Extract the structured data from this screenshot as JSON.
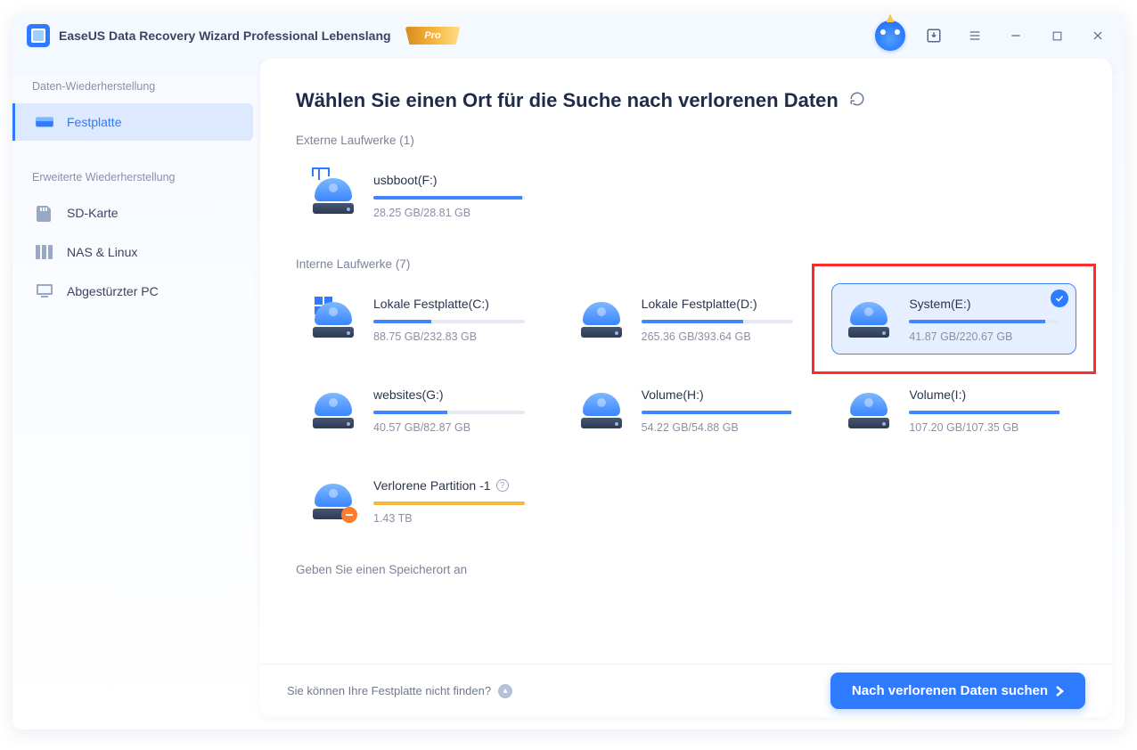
{
  "app_title": "EaseUS Data Recovery Wizard Professional Lebenslang",
  "pro_badge": "Pro",
  "sidebar": {
    "section1_label": "Daten-Wiederherstellung",
    "festplatte": "Festplatte",
    "section2_label": "Erweiterte Wiederherstellung",
    "sdkarte": "SD-Karte",
    "nas": "NAS & Linux",
    "crashed": "Abgestürzter PC"
  },
  "main": {
    "heading": "Wählen Sie einen Ort für die Suche nach verlorenen Daten",
    "section_external": "Externe Laufwerke (1)",
    "section_internal": "Interne Laufwerke (7)",
    "section_custom": "Geben Sie einen Speicherort an",
    "drives_external": [
      {
        "name": "usbboot(F:)",
        "size": "28.25 GB/28.81 GB",
        "pct": 98
      }
    ],
    "drives_internal": [
      {
        "name": "Lokale Festplatte(C:)",
        "size": "88.75 GB/232.83 GB",
        "pct": 38,
        "win": true
      },
      {
        "name": "Lokale Festplatte(D:)",
        "size": "265.36 GB/393.64 GB",
        "pct": 67
      },
      {
        "name": "System(E:)",
        "size": "41.87 GB/220.67 GB",
        "pct": 90,
        "selected": true
      },
      {
        "name": "websites(G:)",
        "size": "40.57 GB/82.87 GB",
        "pct": 49
      },
      {
        "name": "Volume(H:)",
        "size": "54.22 GB/54.88 GB",
        "pct": 99
      },
      {
        "name": "Volume(I:)",
        "size": "107.20 GB/107.35 GB",
        "pct": 99
      },
      {
        "name": "Verlorene Partition -1",
        "size": "1.43 TB",
        "pct": 100,
        "lost": true,
        "yellow": true
      }
    ]
  },
  "footer": {
    "hint": "Sie können Ihre Festplatte nicht finden?",
    "scan": "Nach verlorenen Daten suchen"
  },
  "colors": {
    "accent": "#2f7bff",
    "highlight": "#ff2a2a"
  }
}
